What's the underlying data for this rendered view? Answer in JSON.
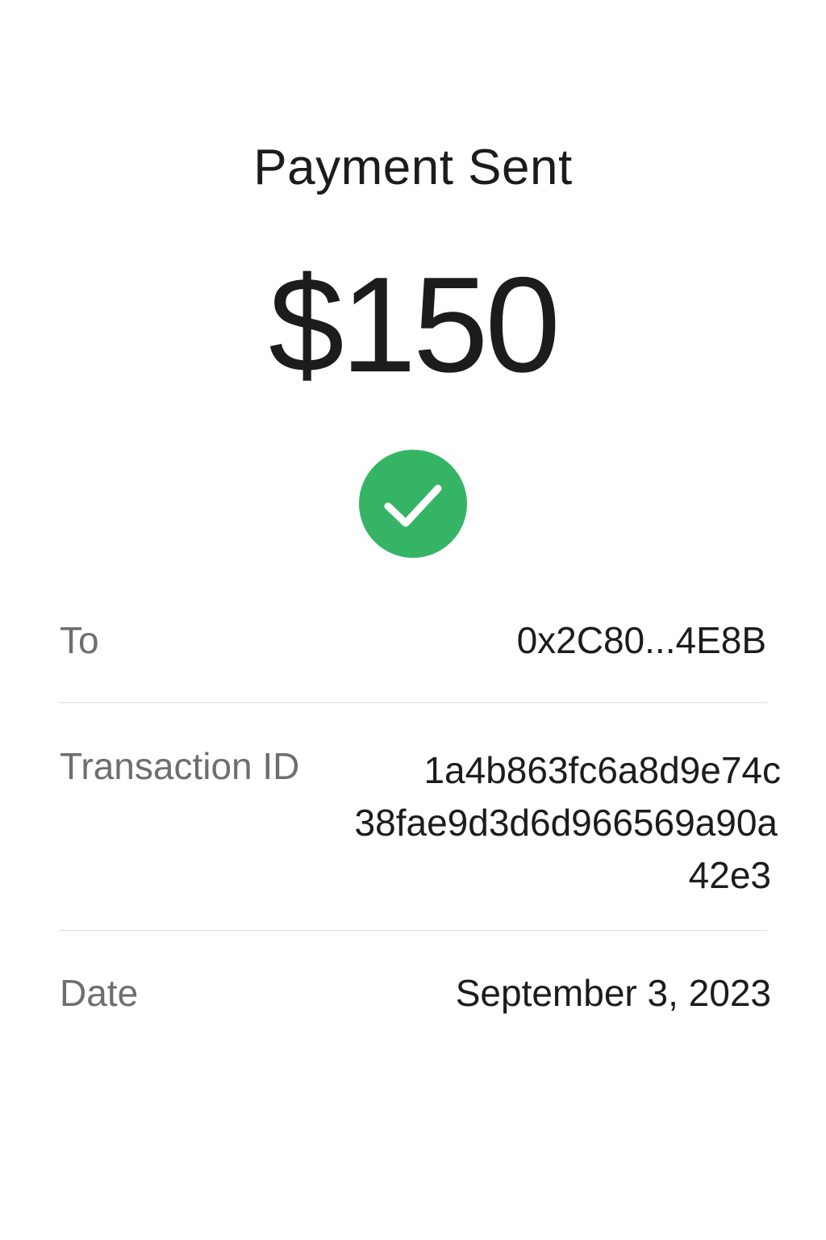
{
  "header": {
    "title": "Payment Sent"
  },
  "payment": {
    "amount": "$150",
    "status_icon": "checkmark-circle-icon",
    "status_color": "#36b466"
  },
  "details": {
    "to": {
      "label": "To",
      "value": "0x2C80...4E8B"
    },
    "transaction_id": {
      "label": "Transaction ID",
      "line1": "1a4b863fc6a8d9e74c",
      "line2": "38fae9d3d6d966569a90a",
      "line3": "42e3"
    },
    "date": {
      "label": "Date",
      "value": "September 3, 2023"
    }
  }
}
